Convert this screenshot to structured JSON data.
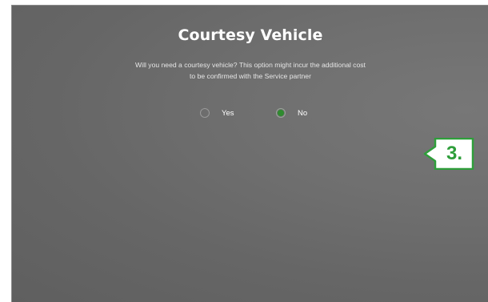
{
  "dialog": {
    "title": "Courtesy Vehicle",
    "description": "Will you need a courtesy vehicle? This option might incur the additional cost to be confirmed with the Service partner",
    "options": [
      {
        "label": "Yes",
        "selected": false
      },
      {
        "label": "No",
        "selected": true
      }
    ],
    "selected_color": "#2e8b2e"
  },
  "annotation": {
    "step_label": "3.",
    "color": "#2e9e3a"
  }
}
